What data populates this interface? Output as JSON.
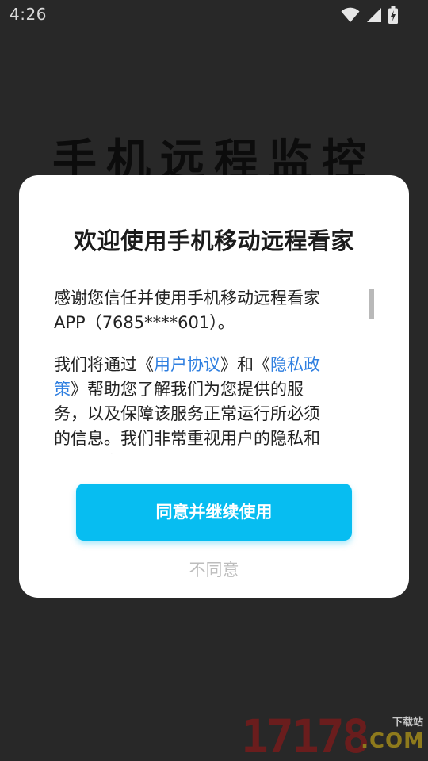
{
  "status_bar": {
    "time": "4:26",
    "icons": [
      "wifi-icon",
      "signal-icon",
      "battery-charging-icon"
    ]
  },
  "app": {
    "title": "手机远程监控"
  },
  "dialog": {
    "title": "欢迎使用手机移动远程看家",
    "paragraph1": "感谢您信任并使用手机移动远程看家APP（7685****601）。",
    "paragraph2": {
      "prefix": "我们将通过《",
      "link_user_agreement": "用户协议",
      "middle": "》和《",
      "link_privacy_policy": "隐私政策",
      "suffix": "》帮助您了解我们为您提供的服务，以及保障该服务正常运行所必须的信息。我们非常重视用户的隐私和个人信息保护。"
    },
    "agree_button": "同意并继续使用",
    "disagree_button": "不同意"
  },
  "watermark": {
    "number": "17178",
    "sub": "下载站",
    "domain": ".COM"
  },
  "colors": {
    "accent": "#07bdf1",
    "link": "#2f7fe0",
    "background": "#282828"
  }
}
